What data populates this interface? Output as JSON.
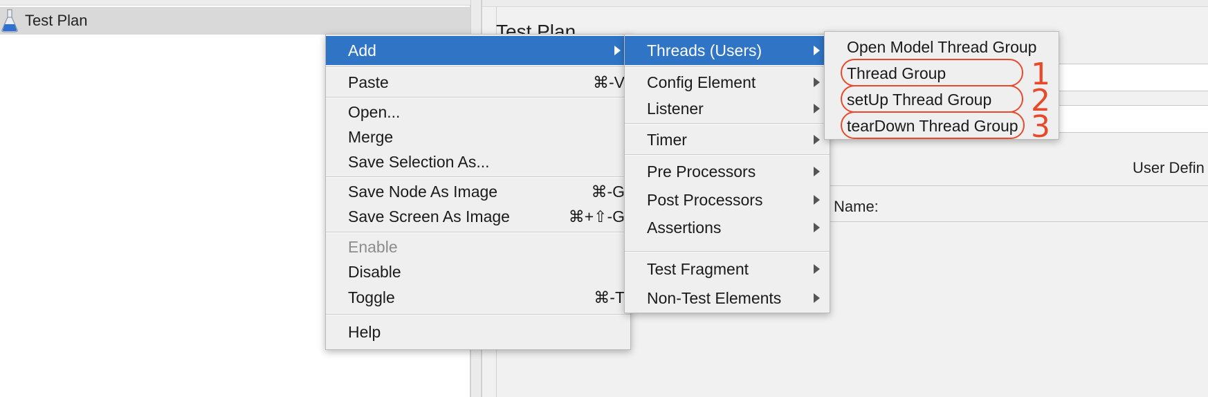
{
  "tree": {
    "root_label": "Test Plan",
    "root_icon": "flask-icon"
  },
  "right_panel": {
    "title": "Test Plan",
    "user_defined_label": "User Defin",
    "name_label": "Name:"
  },
  "context_menu": {
    "items": [
      {
        "label": "Add",
        "shortcut": "",
        "submenu": true,
        "selected": true
      },
      {
        "label": "Paste",
        "shortcut": "⌘-V"
      },
      {
        "label": "Open..."
      },
      {
        "label": "Merge"
      },
      {
        "label": "Save Selection As..."
      },
      {
        "label": "Save Node As Image",
        "shortcut": "⌘-G"
      },
      {
        "label": "Save Screen As Image",
        "shortcut": "⌘+⇧-G"
      },
      {
        "label": "Enable",
        "disabled": true
      },
      {
        "label": "Disable"
      },
      {
        "label": "Toggle",
        "shortcut": "⌘-T"
      },
      {
        "label": "Help"
      }
    ]
  },
  "add_submenu": {
    "items": [
      {
        "label": "Threads (Users)",
        "selected": true
      },
      {
        "label": "Config Element"
      },
      {
        "label": "Listener"
      },
      {
        "label": "Timer"
      },
      {
        "label": "Pre Processors"
      },
      {
        "label": "Post Processors"
      },
      {
        "label": "Assertions"
      },
      {
        "label": "Test Fragment"
      },
      {
        "label": "Non-Test Elements"
      }
    ]
  },
  "threads_submenu": {
    "items": [
      {
        "label": "Open Model Thread Group"
      },
      {
        "label": "Thread Group"
      },
      {
        "label": "setUp Thread Group"
      },
      {
        "label": "tearDown Thread Group"
      }
    ]
  },
  "annotations": {
    "numbers": [
      "1",
      "2",
      "3"
    ],
    "color": "#e8492b"
  },
  "colors": {
    "selection": "#2f74c5",
    "menu_background": "#efefef"
  }
}
